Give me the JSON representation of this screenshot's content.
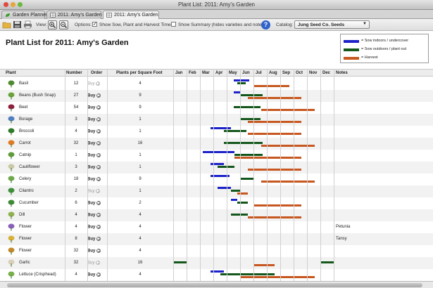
{
  "window": {
    "title": "Plant List: 2011: Amy's Garden"
  },
  "tabs": [
    {
      "label": "Garden Planner",
      "icon": "leaf-icon"
    },
    {
      "label": "2011: Amy's Garden",
      "icon": "grid-icon"
    },
    {
      "label": "2011: Amy's Garden",
      "icon": "grid-icon",
      "active": true
    }
  ],
  "toolbar": {
    "view_label": "View:",
    "options_label": "Options:",
    "option_sow": {
      "label": "Show Sow, Plant and Harvest Times",
      "checked": true,
      "mark": "✓"
    },
    "option_summary": {
      "label": "Show Summary (hides varieties and notes)",
      "checked": false
    },
    "help_label": "?",
    "catalog_label": "Catalog:",
    "catalog_value": "Jung Seed Co. Seeds"
  },
  "page": {
    "title": "Plant List for 2011: Amy's Garden"
  },
  "legend": [
    {
      "label": "= Sow indoors / undercover",
      "color": "#1c22c8"
    },
    {
      "label": "= Sow outdoors / plant out",
      "color": "#14571b"
    },
    {
      "label": "= Harvest",
      "color": "#c7571e"
    }
  ],
  "columns": {
    "plant": "Plant",
    "number": "Number",
    "order": "Order",
    "psf": "Plants per Square Foot",
    "months": [
      "Jan",
      "Feb",
      "Mar",
      "Apr",
      "May",
      "Jun",
      "Jul",
      "Aug",
      "Sep",
      "Oct",
      "Nov",
      "Dec"
    ],
    "notes": "Notes"
  },
  "buy_label": "Buy",
  "rows": [
    {
      "name": "Basil",
      "number": "12",
      "buy_enabled": false,
      "psf": "4",
      "notes": "",
      "icon": "basil-icon",
      "sow_indoor": [
        [
          4.5,
          5.7
        ]
      ],
      "sow_outdoor": [
        [
          4.8,
          5.4
        ]
      ],
      "harvest": [
        [
          6.0,
          8.7
        ]
      ]
    },
    {
      "name": "Beans (Bush Snap)",
      "number": "27",
      "buy_enabled": true,
      "psf": "9",
      "notes": "",
      "icon": "beans-icon",
      "sow_indoor": [
        [
          4.5,
          5.0
        ]
      ],
      "sow_outdoor": [
        [
          5.0,
          6.7
        ]
      ],
      "harvest": [
        [
          5.6,
          9.6
        ]
      ]
    },
    {
      "name": "Beet",
      "number": "54",
      "buy_enabled": true,
      "psf": "9",
      "notes": "",
      "icon": "beet-icon",
      "sow_indoor": [],
      "sow_outdoor": [
        [
          4.5,
          6.5
        ]
      ],
      "harvest": [
        [
          6.6,
          10.6
        ]
      ]
    },
    {
      "name": "Borage",
      "number": "3",
      "buy_enabled": true,
      "psf": "1",
      "notes": "",
      "icon": "borage-icon",
      "sow_indoor": [],
      "sow_outdoor": [
        [
          5.0,
          6.5
        ]
      ],
      "harvest": [
        [
          5.6,
          9.6
        ]
      ]
    },
    {
      "name": "Broccoli",
      "number": "4",
      "buy_enabled": true,
      "psf": "1",
      "notes": "",
      "icon": "broccoli-icon",
      "sow_indoor": [
        [
          2.8,
          4.3
        ]
      ],
      "sow_outdoor": [
        [
          3.8,
          5.5
        ]
      ],
      "harvest": [
        [
          5.6,
          9.6
        ]
      ]
    },
    {
      "name": "Carrot",
      "number": "32",
      "buy_enabled": true,
      "psf": "16",
      "notes": "",
      "icon": "carrot-icon",
      "sow_indoor": [],
      "sow_outdoor": [
        [
          3.8,
          6.7
        ]
      ],
      "harvest": [
        [
          6.6,
          10.6
        ]
      ]
    },
    {
      "name": "Catnip",
      "number": "1",
      "buy_enabled": true,
      "psf": "1",
      "notes": "",
      "icon": "catnip-icon",
      "sow_indoor": [
        [
          2.2,
          4.6
        ]
      ],
      "sow_outdoor": [
        [
          4.6,
          6.7
        ]
      ],
      "harvest": [
        [
          4.6,
          9.6
        ]
      ]
    },
    {
      "name": "Cauliflower",
      "number": "3",
      "buy_enabled": true,
      "psf": "1",
      "notes": "",
      "icon": "cauliflower-icon",
      "sow_indoor": [
        [
          2.8,
          3.8
        ]
      ],
      "sow_outdoor": [
        [
          3.3,
          4.6
        ]
      ],
      "harvest": [
        [
          5.6,
          9.6
        ]
      ]
    },
    {
      "name": "Celery",
      "number": "18",
      "buy_enabled": true,
      "psf": "9",
      "notes": "",
      "icon": "celery-icon",
      "sow_indoor": [
        [
          2.8,
          4.2
        ]
      ],
      "sow_outdoor": [
        [
          5.0,
          6.0
        ]
      ],
      "harvest": [
        [
          6.6,
          10.6
        ]
      ]
    },
    {
      "name": "Cilantro",
      "number": "2",
      "buy_enabled": false,
      "psf": "1",
      "notes": "",
      "icon": "cilantro-icon",
      "sow_indoor": [
        [
          3.3,
          4.3
        ]
      ],
      "sow_outdoor": [
        [
          4.3,
          5.0
        ]
      ],
      "harvest": [
        [
          4.8,
          5.6
        ]
      ]
    },
    {
      "name": "Cucumber",
      "number": "6",
      "buy_enabled": true,
      "psf": "2",
      "notes": "",
      "icon": "cucumber-icon",
      "sow_indoor": [
        [
          4.3,
          4.8
        ]
      ],
      "sow_outdoor": [
        [
          4.8,
          5.6
        ]
      ],
      "harvest": [
        [
          6.0,
          9.6
        ]
      ]
    },
    {
      "name": "Dill",
      "number": "4",
      "buy_enabled": true,
      "psf": "4",
      "notes": "",
      "icon": "dill-icon",
      "sow_indoor": [],
      "sow_outdoor": [
        [
          4.3,
          5.6
        ]
      ],
      "harvest": [
        [
          5.6,
          9.6
        ]
      ]
    },
    {
      "name": "Flower",
      "number": "4",
      "buy_enabled": true,
      "psf": "4",
      "notes": "Petunia",
      "icon": "flower-icon",
      "sow_indoor": [],
      "sow_outdoor": [],
      "harvest": []
    },
    {
      "name": "Flower",
      "number": "8",
      "buy_enabled": true,
      "psf": "4",
      "notes": "Tansy",
      "icon": "flower-icon",
      "sow_indoor": [],
      "sow_outdoor": [],
      "harvest": []
    },
    {
      "name": "Flower",
      "number": "32",
      "buy_enabled": true,
      "psf": "4",
      "notes": "",
      "icon": "flower-icon",
      "sow_indoor": [],
      "sow_outdoor": [],
      "harvest": []
    },
    {
      "name": "Garlic",
      "number": "32",
      "buy_enabled": false,
      "psf": "16",
      "notes": "",
      "icon": "garlic-icon",
      "sow_indoor": [],
      "sow_outdoor": [
        [
          0.0,
          1.0
        ],
        [
          11.0,
          12.6
        ]
      ],
      "harvest": [
        [
          6.0,
          7.6
        ]
      ]
    },
    {
      "name": "Lettuce (Crisphead)",
      "number": "4",
      "buy_enabled": true,
      "psf": "4",
      "notes": "",
      "icon": "lettuce-icon",
      "sow_indoor": [
        [
          2.8,
          3.8
        ]
      ],
      "sow_outdoor": [
        [
          3.5,
          7.6
        ]
      ],
      "harvest": [
        [
          5.0,
          10.6
        ]
      ]
    }
  ]
}
